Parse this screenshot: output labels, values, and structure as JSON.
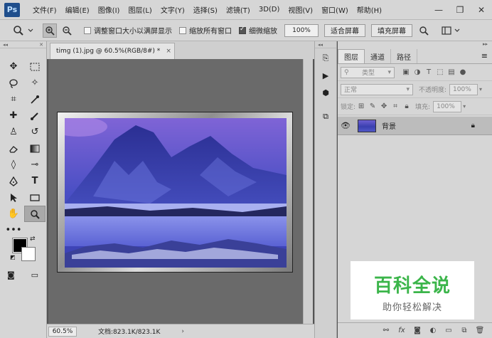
{
  "app": {
    "logo": "Ps"
  },
  "menu": [
    "文件(F)",
    "编辑(E)",
    "图像(I)",
    "图层(L)",
    "文字(Y)",
    "选择(S)",
    "滤镜(T)",
    "3D(D)",
    "视图(V)",
    "窗口(W)",
    "帮助(H)"
  ],
  "window_controls": {
    "minimize": "—",
    "restore": "❐",
    "close": "✕"
  },
  "options": {
    "resize_windows": "调整窗口大小以满屏显示",
    "zoom_all": "缩放所有窗口",
    "scrubby_zoom": "细微缩放",
    "zoom_value": "100%",
    "fit_screen": "适合屏幕",
    "fill_screen": "填充屏幕",
    "resize_windows_checked": false,
    "zoom_all_checked": false,
    "scrubby_zoom_checked": true
  },
  "document": {
    "tab_title": "timg (1).jpg @ 60.5%(RGB/8#) *",
    "close": "×",
    "zoom": "60.5%",
    "doc_info": "文档:823.1K/823.1K",
    "status_arrow": "›"
  },
  "layers_panel": {
    "tabs": [
      "图层",
      "通道",
      "路径"
    ],
    "active_tab": "图层",
    "menu": "≡",
    "filter_kind": "类型",
    "blend_mode": "正常",
    "opacity_label": "不透明度:",
    "opacity_value": "100%",
    "lock_label": "锁定:",
    "fill_label": "填充:",
    "fill_value": "100%",
    "layers": [
      {
        "name": "背景",
        "visible": true,
        "locked": true
      }
    ],
    "bottom_icons": [
      "link-icon",
      "fx-icon",
      "mask-icon",
      "adjustment-icon",
      "folder-icon",
      "new-layer-icon",
      "trash-icon"
    ]
  },
  "watermark": {
    "title": "百科全说",
    "subtitle": "助你轻松解决"
  },
  "colors": {
    "foreground": "#000000",
    "background": "#ffffff",
    "watermark_green": "#3bb54a"
  }
}
